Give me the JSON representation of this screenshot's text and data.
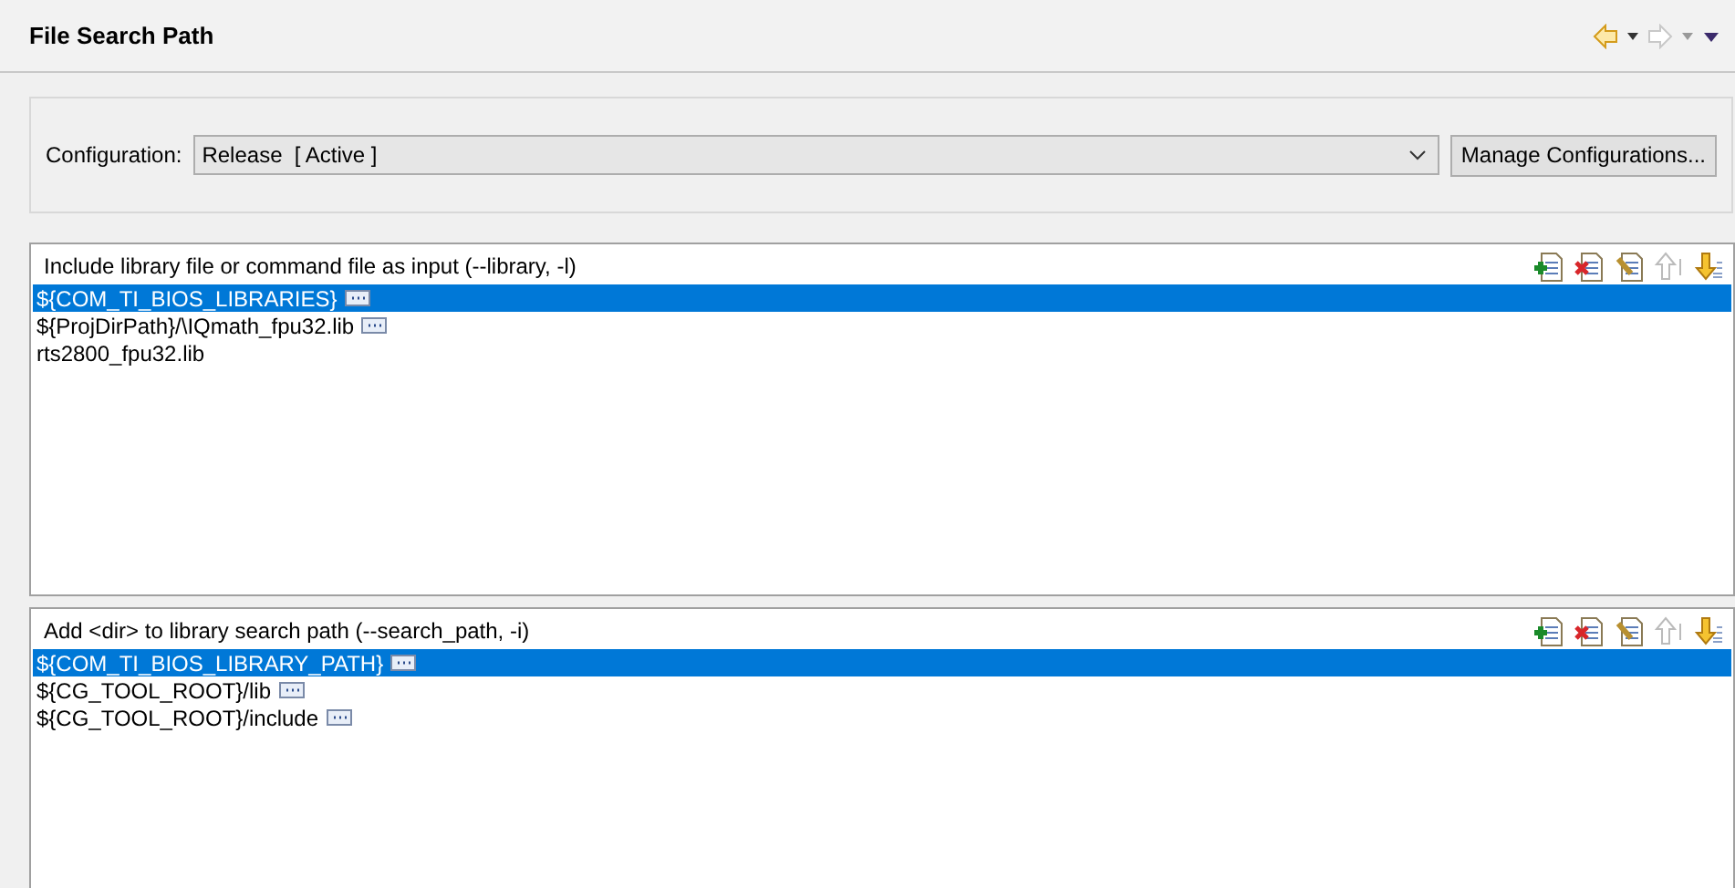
{
  "header": {
    "title": "File Search Path",
    "nav": [
      {
        "kind": "back",
        "disabled": false
      },
      {
        "kind": "forward",
        "disabled": true
      },
      {
        "kind": "menu",
        "disabled": false
      }
    ]
  },
  "configuration": {
    "label": "Configuration:",
    "value": "Release  [ Active ]",
    "button": "Manage Configurations..."
  },
  "panels": [
    {
      "title": "Include library file or command file as input (--library, -l)",
      "tools": [
        {
          "kind": "add",
          "disabled": false
        },
        {
          "kind": "delete",
          "disabled": false
        },
        {
          "kind": "edit",
          "disabled": false
        },
        {
          "kind": "up",
          "disabled": true
        },
        {
          "kind": "down",
          "disabled": false
        }
      ],
      "items": [
        {
          "text": "${COM_TI_BIOS_LIBRARIES}",
          "ellipsis": true,
          "selected": true
        },
        {
          "text": "${ProjDirPath}/\\IQmath_fpu32.lib",
          "ellipsis": true,
          "selected": false
        },
        {
          "text": "rts2800_fpu32.lib",
          "ellipsis": false,
          "selected": false
        }
      ]
    },
    {
      "title": "Add <dir> to library search path (--search_path, -i)",
      "tools": [
        {
          "kind": "add",
          "disabled": false
        },
        {
          "kind": "delete",
          "disabled": false
        },
        {
          "kind": "edit",
          "disabled": false
        },
        {
          "kind": "up",
          "disabled": true
        },
        {
          "kind": "down",
          "disabled": false
        }
      ],
      "items": [
        {
          "text": "${COM_TI_BIOS_LIBRARY_PATH}",
          "ellipsis": true,
          "selected": true
        },
        {
          "text": "${CG_TOOL_ROOT}/lib",
          "ellipsis": true,
          "selected": false
        },
        {
          "text": "${CG_TOOL_ROOT}/include",
          "ellipsis": true,
          "selected": false
        }
      ]
    }
  ]
}
